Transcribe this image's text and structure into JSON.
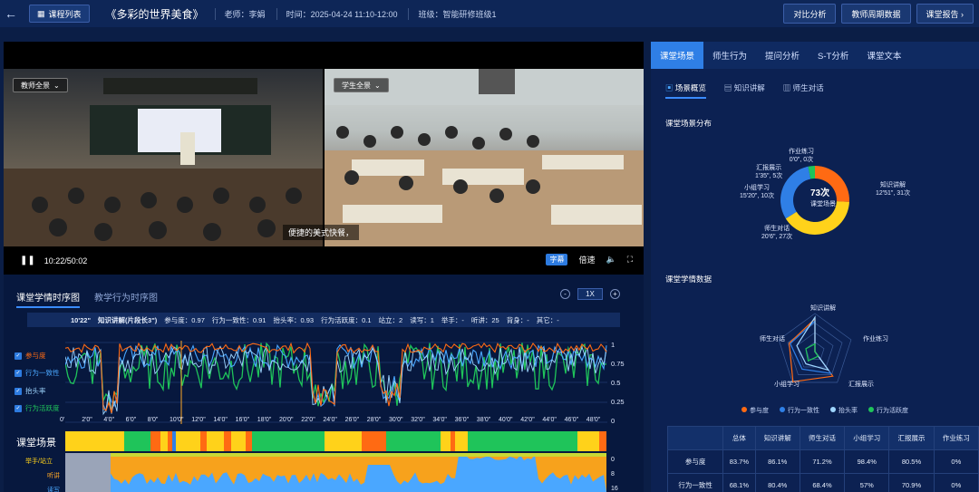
{
  "header": {
    "back_icon": "arrow-left-icon",
    "course_list": "课程列表",
    "title": "《多彩的世界美食》",
    "teacher": "老师：李娟",
    "time": "时间：2025-04-24 11:10-12:00",
    "class": "班级：智能研修班级1",
    "btn_compare": "对比分析",
    "btn_cycle": "教师周期数据",
    "btn_report": "课堂报告 ›"
  },
  "video": {
    "cam1_label": "教师全景",
    "cam2_label": "学生全景",
    "subtitle": "便捷的美式快餐，",
    "time": "10:22/50:02",
    "rate_label": "字幕",
    "speed_label": "倍速"
  },
  "timeline": {
    "tab1": "课堂学情时序图",
    "tab2": "教学行为时序图",
    "zoom": "1X",
    "info": [
      "10'22\"",
      "知识讲解(片段长3\")",
      "参与度：0.97",
      "行为一致性：0.91",
      "抬头率：0.93",
      "行为活跃度：0.1",
      "站立：2",
      "读写：1",
      "举手：-",
      "听讲：25",
      "背身：-",
      "其它：-"
    ],
    "legend": [
      "参与度",
      "行为一致性",
      "抬头率",
      "行为活跃度"
    ],
    "yticks": [
      "1",
      "0.75",
      "0.5",
      "0.25",
      "0"
    ],
    "xticks": [
      "0'",
      "2'0\"",
      "4'0\"",
      "6'0\"",
      "8'0\"",
      "10'0\"",
      "12'0\"",
      "14'0\"",
      "16'0\"",
      "18'0\"",
      "20'0\"",
      "22'0\"",
      "24'0\"",
      "26'0\"",
      "28'0\"",
      "30'0\"",
      "32'0\"",
      "34'0\"",
      "36'0\"",
      "38'0\"",
      "40'0\"",
      "42'0\"",
      "44'0\"",
      "46'0\"",
      "48'0\""
    ],
    "scene_title": "课堂场景",
    "act_labels": [
      "举手/站立",
      "听讲",
      "读写"
    ],
    "act_ticks": [
      "0",
      "8",
      "16"
    ]
  },
  "right": {
    "tabs": [
      "课堂场景",
      "师生行为",
      "提问分析",
      "S-T分析",
      "课堂文本"
    ],
    "subtabs": [
      "场景概览",
      "知识讲解",
      "师生对话"
    ],
    "dist_title": "课堂场景分布",
    "donut_center": "73次",
    "donut_center_sub": "课堂场景",
    "donut_labels": [
      {
        "name": "作业练习",
        "val": "0'0\", 0次"
      },
      {
        "name": "汇报展示",
        "val": "1'35\", 5次"
      },
      {
        "name": "小组学习",
        "val": "15'20\", 10次"
      },
      {
        "name": "知识讲解",
        "val": "12'51\", 31次"
      },
      {
        "name": "师生对话",
        "val": "20'6\", 27次"
      }
    ],
    "data_title": "课堂学情数据",
    "radar_labels": [
      "知识讲解",
      "作业练习",
      "汇报展示",
      "小组学习",
      "师生对话"
    ],
    "legend": [
      "参与度",
      "行为一致性",
      "抬头率",
      "行为活跃度"
    ],
    "table": {
      "headers": [
        "",
        "总体",
        "知识讲解",
        "师生对话",
        "小组学习",
        "汇报展示",
        "作业练习"
      ],
      "rows": [
        [
          "参与度",
          "83.7%",
          "86.1%",
          "71.2%",
          "98.4%",
          "80.5%",
          "0%"
        ],
        [
          "行为一致性",
          "68.1%",
          "80.4%",
          "68.4%",
          "57%",
          "70.9%",
          "0%"
        ]
      ]
    }
  },
  "chart_data": {
    "type": "pie",
    "title": "课堂场景分布",
    "categories": [
      "知识讲解",
      "师生对话",
      "小组学习",
      "汇报展示",
      "作业练习"
    ],
    "values": [
      12.85,
      20.1,
      15.33,
      1.58,
      0
    ],
    "counts": [
      31,
      27,
      10,
      5,
      0
    ],
    "colors": [
      "#ff6a13",
      "#ffd21a",
      "#2f7fe6",
      "#1fc45a",
      "#9aa9c8"
    ]
  },
  "colors": {
    "accent": "#2f7fe6",
    "orange": "#ff6a13",
    "yellow": "#ffd21a",
    "green": "#1fc45a",
    "blue": "#4aa7ff"
  }
}
